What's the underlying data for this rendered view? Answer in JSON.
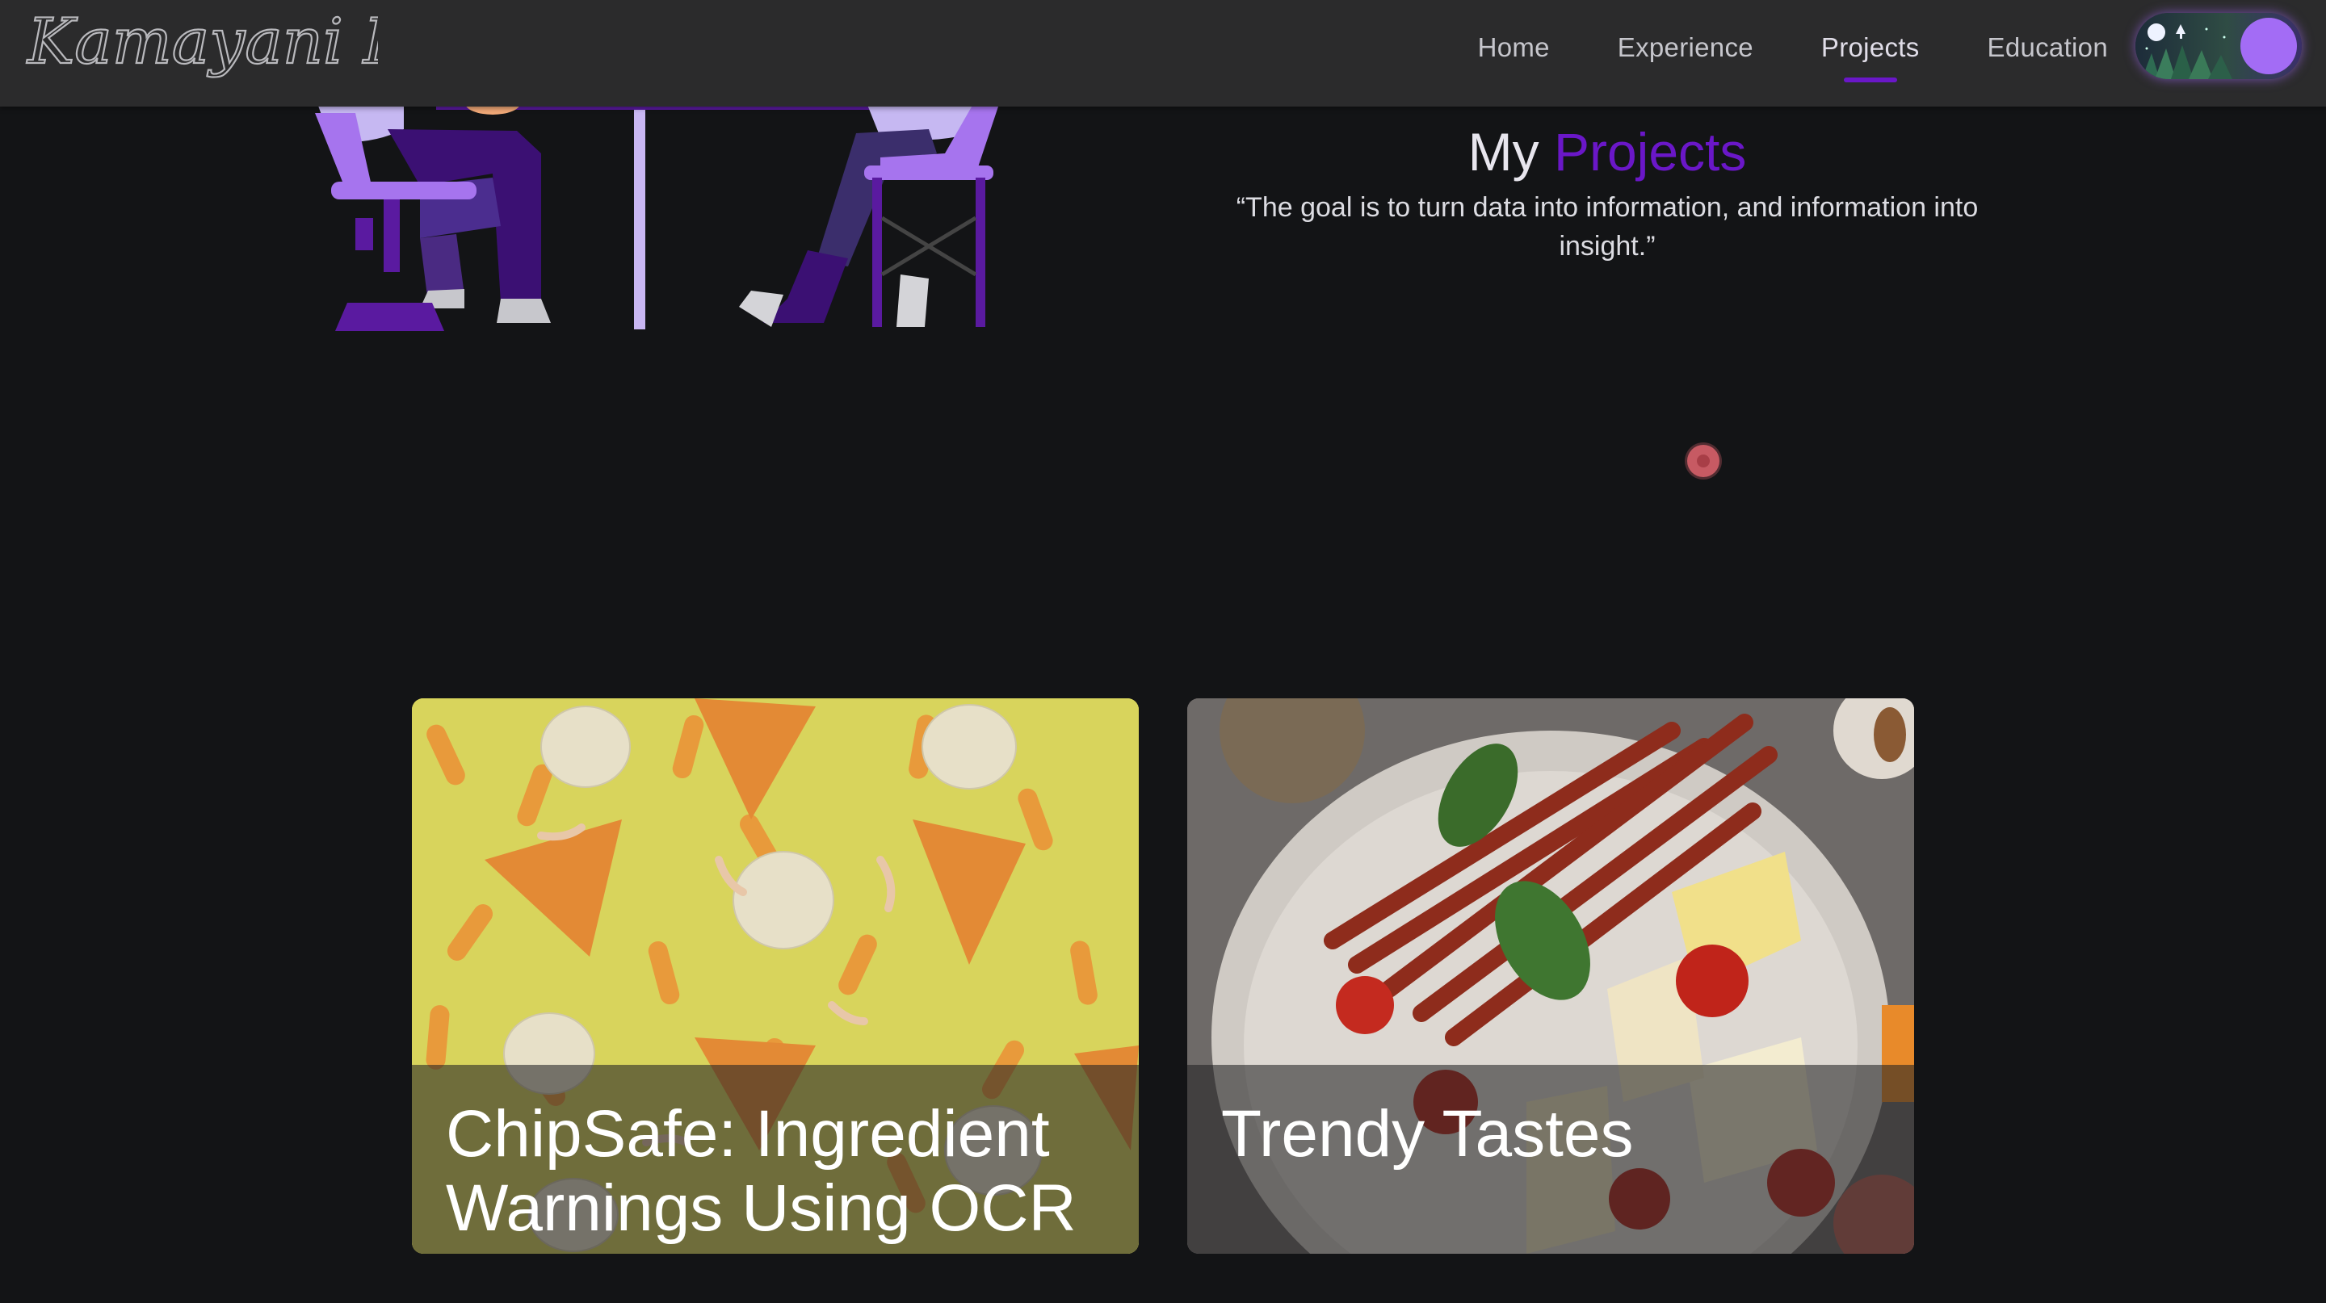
{
  "navbar": {
    "logo_text": "Kamayani Rai",
    "links": [
      {
        "label": "Home"
      },
      {
        "label": "Experience"
      },
      {
        "label": "Projects",
        "active": true
      },
      {
        "label": "Education"
      }
    ],
    "theme_toggle_state": "dark"
  },
  "section": {
    "title_prefix": "My",
    "title_accent": "Projects",
    "quote": "“The goal is to turn data into information, and information into insight.”"
  },
  "projects": [
    {
      "title": "ChipSafe: Ingredient Warnings Using OCR"
    },
    {
      "title": "Trendy Tastes"
    }
  ],
  "colors": {
    "accent": "#6a17c8",
    "background": "#131416",
    "navbar": "#2b2b2c",
    "cursor": "#c75a63"
  }
}
